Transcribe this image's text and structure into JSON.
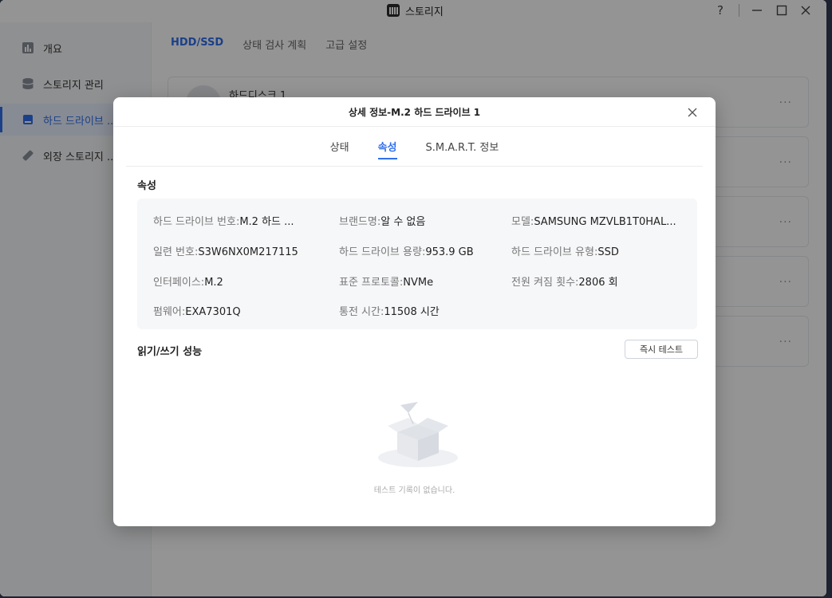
{
  "window": {
    "title": "스토리지",
    "controls": {
      "help": "?",
      "minimize": "—",
      "maximize": "☐",
      "close": "✕"
    }
  },
  "sidebar": {
    "items": [
      {
        "label": "개요",
        "icon": "chart-icon"
      },
      {
        "label": "스토리지 관리",
        "icon": "database-icon"
      },
      {
        "label": "하드 드라이브 ...",
        "icon": "hard-drive-icon",
        "active": true
      },
      {
        "label": "외장 스토리지 ...",
        "icon": "usb-drive-icon"
      }
    ]
  },
  "main": {
    "tabs": [
      "HDD/SSD",
      "상태 검사 계획",
      "고급 설정"
    ],
    "first_disk_name": "하드디스크 1",
    "card_dots": "···"
  },
  "dialog": {
    "title": "상세 정보-M.2 하드 드라이브 1",
    "tabs": [
      "상태",
      "속성",
      "S.M.A.R.T. 정보"
    ],
    "active_tab": "속성",
    "properties_title": "속성",
    "properties": {
      "drive_no": {
        "key": "하드 드라이브 번호:",
        "value": "M.2 하드 ..."
      },
      "brand": {
        "key": "브랜드명:",
        "value": "알 수 없음"
      },
      "model": {
        "key": "모델:",
        "value": "SAMSUNG MZVLB1T0HAL..."
      },
      "serial": {
        "key": "일련 번호:",
        "value": "S3W6NX0M217115"
      },
      "capacity": {
        "key": "하드 드라이브 용량:",
        "value": "953.9 GB"
      },
      "type": {
        "key": "하드 드라이브 유형:",
        "value": "SSD"
      },
      "interface": {
        "key": "인터페이스:",
        "value": "M.2"
      },
      "protocol": {
        "key": "표준 프로토콜:",
        "value": "NVMe"
      },
      "power_on_count": {
        "key": "전원 켜짐 횟수:",
        "value": "2806 회"
      },
      "firmware": {
        "key": "펌웨어:",
        "value": "EXA7301Q"
      },
      "power_on_hours": {
        "key": "통전 시간:",
        "value": "11508 시간"
      }
    },
    "perf_title": "읽기/쓰기 성능",
    "test_button": "즉시 테스트",
    "empty_text": "테스트 기록이 없습니다."
  }
}
